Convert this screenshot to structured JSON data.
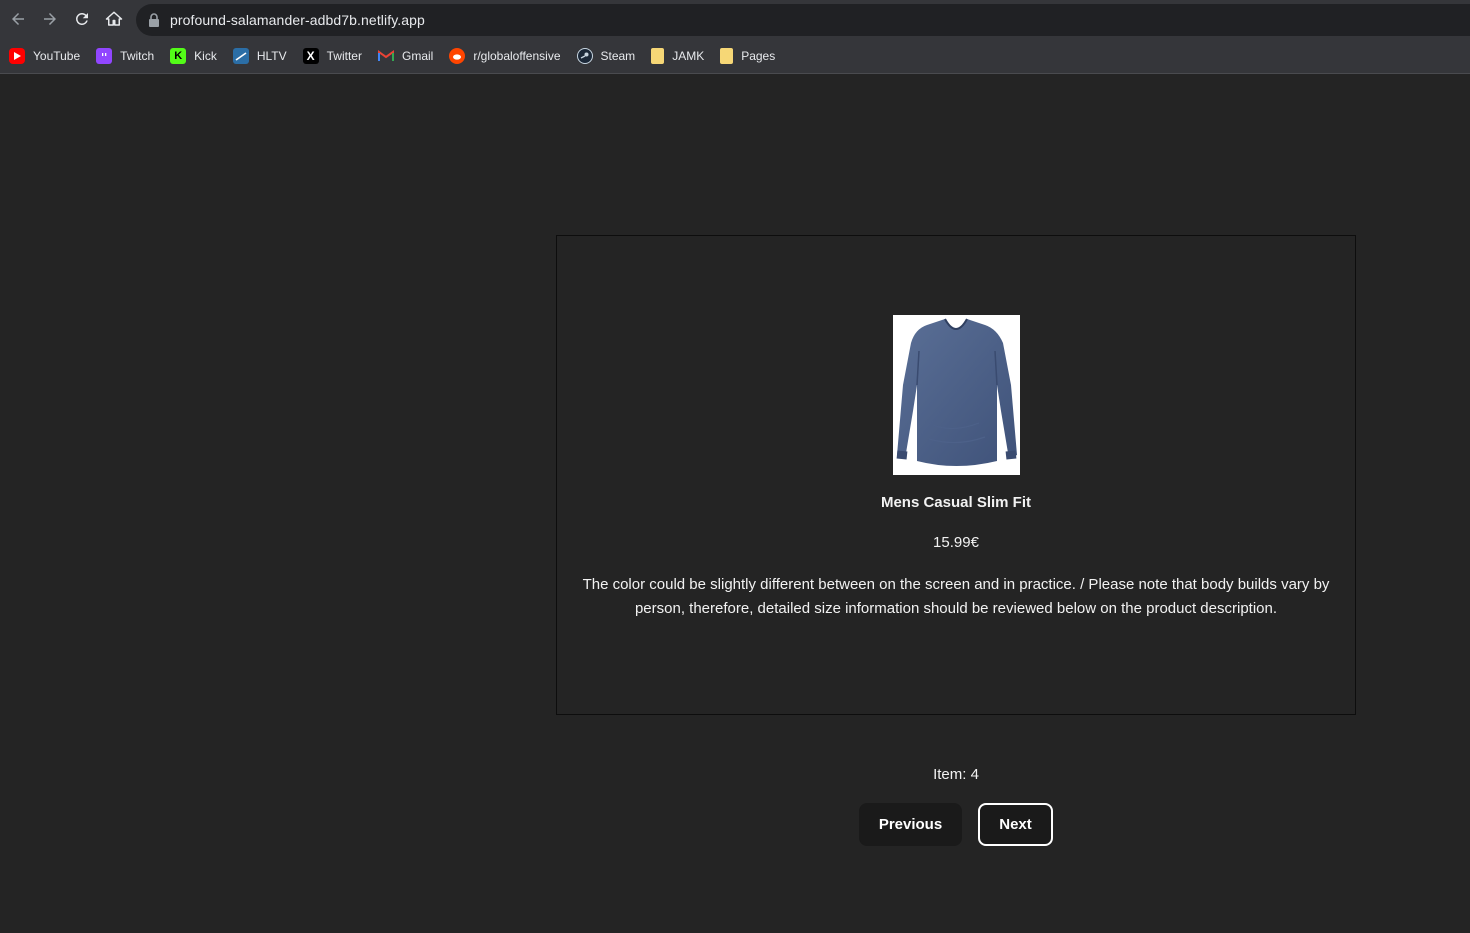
{
  "browser": {
    "url": "profound-salamander-adbd7b.netlify.app",
    "nav": {
      "back_icon": "arrow-left-icon",
      "forward_icon": "arrow-right-icon",
      "reload_icon": "reload-icon",
      "home_icon": "home-icon"
    },
    "bookmarks": [
      {
        "label": "YouTube",
        "icon": "youtube-icon",
        "color": "#ff0000"
      },
      {
        "label": "Twitch",
        "icon": "twitch-icon",
        "color": "#9146ff"
      },
      {
        "label": "Kick",
        "icon": "kick-icon",
        "color": "#53fc18"
      },
      {
        "label": "HLTV",
        "icon": "hltv-icon",
        "color": "#2b6ea6"
      },
      {
        "label": "Twitter",
        "icon": "x-icon",
        "color": "#000000"
      },
      {
        "label": "Gmail",
        "icon": "gmail-icon",
        "color": "#ea4335"
      },
      {
        "label": "r/globaloffensive",
        "icon": "reddit-icon",
        "color": "#ff4500"
      },
      {
        "label": "Steam",
        "icon": "steam-icon",
        "color": "#1b2838"
      },
      {
        "label": "JAMK",
        "icon": "folder-icon",
        "color": "#f6d776"
      },
      {
        "label": "Pages",
        "icon": "folder-icon",
        "color": "#f6d776"
      }
    ]
  },
  "product": {
    "image_icon": "long-sleeve-shirt-image",
    "title": "Mens Casual Slim Fit",
    "price": "15.99€",
    "description": "The color could be slightly different between on the screen and in practice. / Please note that body builds vary by person, therefore, detailed size information should be reviewed below on the product description."
  },
  "pager": {
    "item_label": "Item: 4",
    "previous_label": "Previous",
    "next_label": "Next"
  },
  "colors": {
    "page_bg": "#242424",
    "button_bg": "#1a1a1a",
    "shirt": "#4a5f86"
  }
}
